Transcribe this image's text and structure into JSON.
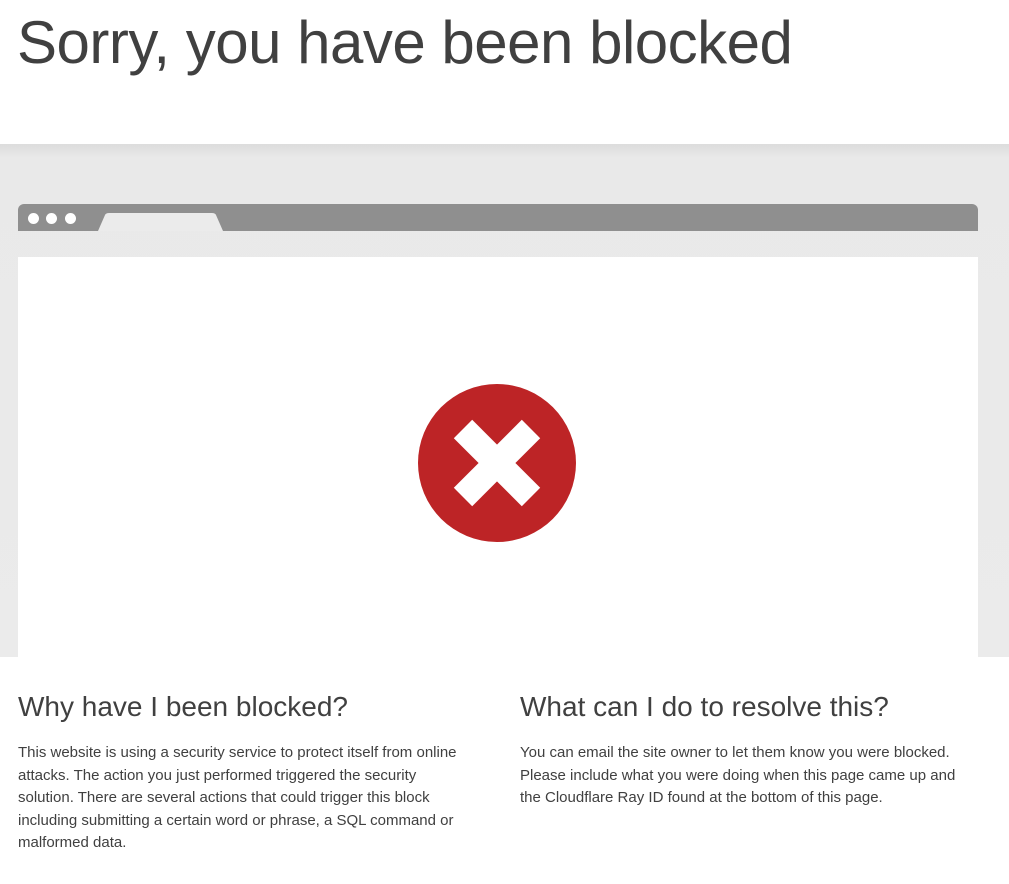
{
  "header": {
    "title": "Sorry, you have been blocked"
  },
  "browser_mock": {
    "icon": "block-x-icon",
    "icon_color": "#bd2426",
    "bar_color": "#8f8f8f"
  },
  "why_blocked": {
    "heading": "Why have I been blocked?",
    "body": "This website is using a security service to protect itself from online attacks. The action you just performed triggered the security solution. There are several actions that could trigger this block including submitting a certain word or phrase, a SQL command or malformed data."
  },
  "resolve": {
    "heading": "What can I do to resolve this?",
    "body": "You can email the site owner to let them know you were blocked. Please include what you were doing when this page came up and the Cloudflare Ray ID found at the bottom of this page."
  }
}
